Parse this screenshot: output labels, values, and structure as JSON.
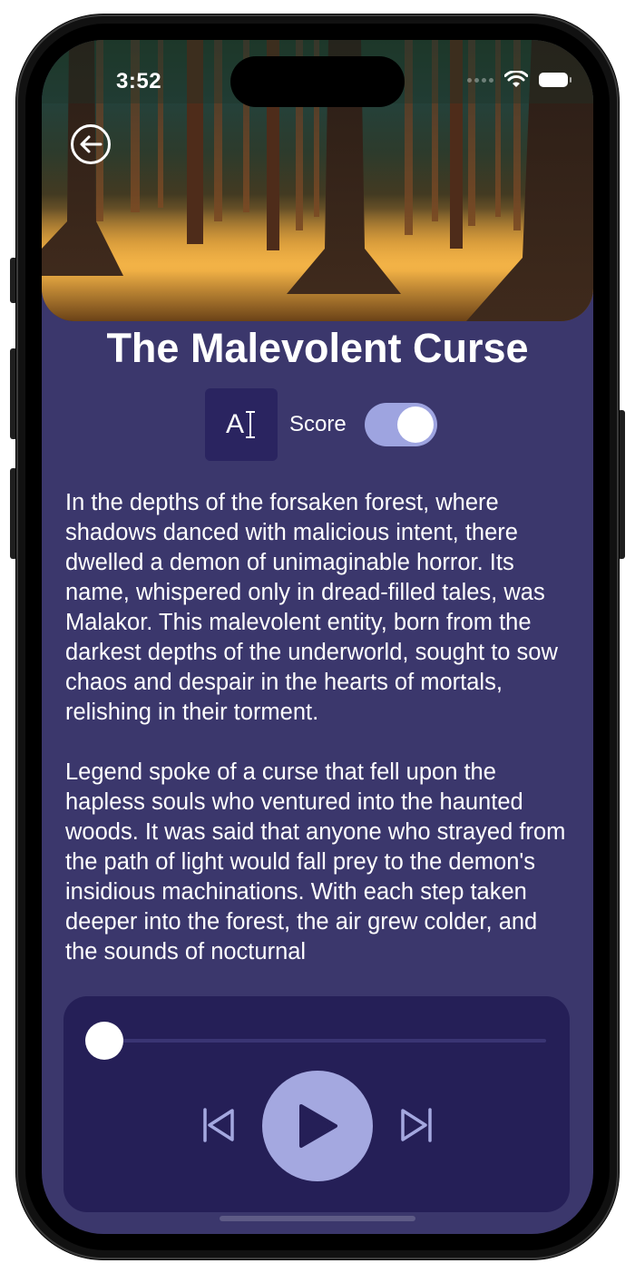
{
  "status_bar": {
    "time": "3:52"
  },
  "story": {
    "title": "The Malevolent Curse",
    "paragraphs": [
      "In the depths of the forsaken forest, where shadows danced with malicious intent, there dwelled a demon of unimaginable horror. Its name, whispered only in dread-filled tales, was Malakor. This malevolent entity, born from the darkest depths of the underworld, sought to sow chaos and despair in the hearts of mortals, relishing in their torment.",
      "Legend spoke of a curse that fell upon the hapless souls who ventured into the haunted woods. It was said that anyone who strayed from the path of light would fall prey to the demon's insidious machinations. With each step taken deeper into the forest, the air grew colder, and the sounds of nocturnal"
    ]
  },
  "controls": {
    "text_size_label": "A",
    "score_label": "Score",
    "score_enabled": true
  },
  "player": {
    "progress": 0.0,
    "is_playing": false
  },
  "colors": {
    "background": "#3b376c",
    "player_panel": "#251f57",
    "accent": "#a4a8e0"
  }
}
